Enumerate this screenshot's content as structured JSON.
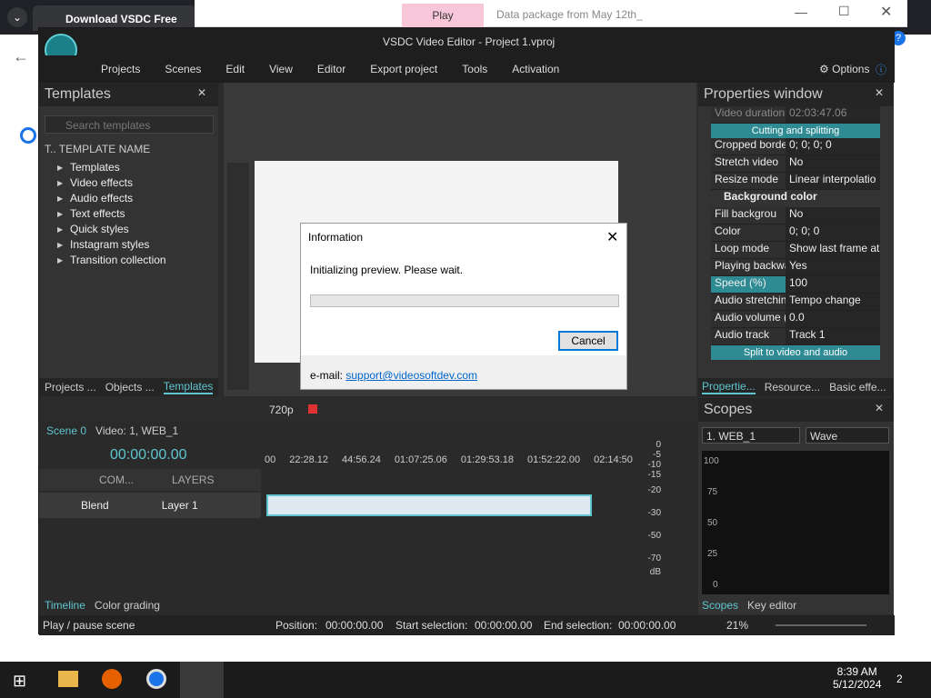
{
  "browser": {
    "tab_title": "Download VSDC Free Vide",
    "explorer_play": "Play",
    "explorer_title": "Data package from May 12th_"
  },
  "app": {
    "title": "VSDC Video Editor - Project 1.vproj",
    "options": "Options"
  },
  "menu": [
    "Projects",
    "Scenes",
    "Edit",
    "View",
    "Editor",
    "Export project",
    "Tools",
    "Activation"
  ],
  "templates": {
    "title": "Templates",
    "search_placeholder": "Search templates",
    "column": "TEMPLATE NAME",
    "col_short": "T..",
    "items": [
      "Templates",
      "Video effects",
      "Audio effects",
      "Text effects",
      "Quick styles",
      "Instagram styles",
      "Transition collection"
    ]
  },
  "left_tabs": [
    "Projects ...",
    "Objects ...",
    "Templates"
  ],
  "properties": {
    "title": "Properties window",
    "video_duration_label": "Video duration",
    "video_duration": "02:03:47.06",
    "cutting_btn": "Cutting and splitting",
    "rows": [
      {
        "k": "Cropped borde",
        "v": "0; 0; 0; 0"
      },
      {
        "k": "Stretch video",
        "v": "No"
      },
      {
        "k": "Resize mode",
        "v": "Linear interpolatio"
      }
    ],
    "bg_color": "Background color",
    "rows2": [
      {
        "k": "Fill backgrou",
        "v": "No"
      },
      {
        "k": "Color",
        "v": "0; 0; 0"
      }
    ],
    "rows3": [
      {
        "k": "Loop mode",
        "v": "Show last frame at"
      },
      {
        "k": "Playing backwa",
        "v": "Yes"
      },
      {
        "k": "Speed (%)",
        "v": "100"
      },
      {
        "k": "Audio stretchin",
        "v": "Tempo change"
      },
      {
        "k": "Audio volume (",
        "v": "0.0"
      },
      {
        "k": "Audio track",
        "v": "Track 1"
      }
    ],
    "split_btn": "Split to video and audio",
    "tabs": [
      "Propertie...",
      "Resource...",
      "Basic effe..."
    ]
  },
  "scopes": {
    "title": "Scopes",
    "source": "1. WEB_1",
    "mode": "Wave",
    "yaxis": [
      "100",
      "75",
      "50",
      "25",
      "0"
    ],
    "tabs": [
      "Scopes",
      "Key editor"
    ]
  },
  "dialog": {
    "title": "Information",
    "message": "Initializing preview. Please wait.",
    "cancel": "Cancel",
    "email_label": "e-mail:",
    "email": "support@videosoftdev.com",
    "progress": 0
  },
  "toolbar2": {
    "resolution": "720p"
  },
  "timeline": {
    "scene_tab": "Scene 0",
    "video_tab": "Video: 1,  WEB_1",
    "time": "00:00:00.00",
    "com": "COM...",
    "layers": "LAYERS",
    "blend": "Blend",
    "layer": "Layer 1",
    "ruler": [
      "00",
      "22:28.12",
      "44:56.24",
      "01:07:25.06",
      "01:29:53.18",
      "01:52:22.00",
      "02:14:50"
    ],
    "db": [
      "0",
      "-5",
      "-10",
      "-15",
      "-20",
      "-30",
      "-50",
      "-70",
      "dB"
    ],
    "bottom_tabs": [
      "Timeline",
      "Color grading"
    ]
  },
  "status": {
    "left": "Play / pause scene",
    "position_label": "Position:",
    "position": "00:00:00.00",
    "start_label": "Start selection:",
    "start": "00:00:00.00",
    "end_label": "End selection:",
    "end": "00:00:00.00",
    "zoom": "21%"
  },
  "taskbar": {
    "time": "8:39 AM",
    "date": "5/12/2024",
    "notif": "2"
  }
}
